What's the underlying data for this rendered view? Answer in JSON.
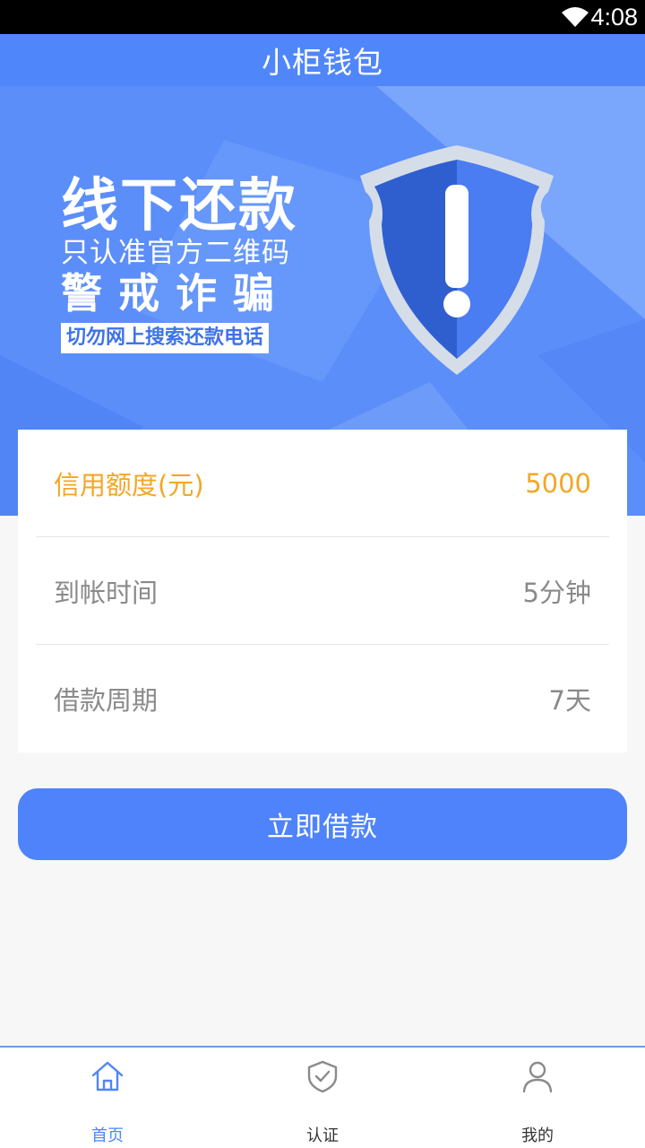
{
  "status_bar": {
    "time": "4:08",
    "icon": "wifi-icon"
  },
  "header": {
    "title": "小柜钱包"
  },
  "banner": {
    "line1": "线下还款",
    "line2": "只认准官方二维码",
    "line3": "警戒诈骗",
    "tag": "切勿网上搜索还款电话",
    "icon": "shield-exclamation-icon"
  },
  "info": {
    "rows": [
      {
        "label": "信用额度(元)",
        "value": "5000"
      },
      {
        "label": "到帐时间",
        "value": "5分钟"
      },
      {
        "label": "借款周期",
        "value": "7天"
      }
    ]
  },
  "action": {
    "borrow_label": "立即借款"
  },
  "tabs": [
    {
      "label": "首页",
      "icon": "home-icon"
    },
    {
      "label": "认证",
      "icon": "shield-check-icon"
    },
    {
      "label": "我的",
      "icon": "user-icon"
    }
  ],
  "colors": {
    "primary": "#4f86fa",
    "highlight": "#f5a623",
    "text_muted": "#8a8a8a"
  }
}
